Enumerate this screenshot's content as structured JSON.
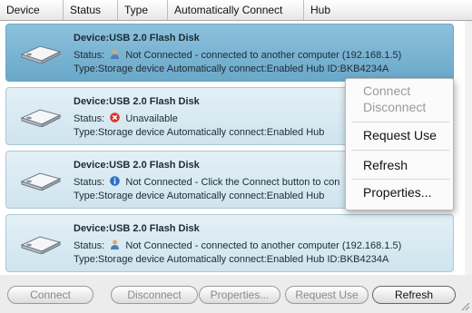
{
  "columns": [
    "Device",
    "Status",
    "Type",
    "Automatically Connect",
    "Hub"
  ],
  "devices": [
    {
      "title": "Device:USB 2.0 Flash Disk",
      "status_prefix": "Status:",
      "status_icon": "user-icon",
      "status_text": "Not Connected - connected to another computer (192.168.1.5)",
      "type_text": "Type:Storage device   Automatically connect:Enabled   Hub ID:BKB4234A",
      "selected": true
    },
    {
      "title": "Device:USB 2.0 Flash Disk",
      "status_prefix": "Status:",
      "status_icon": "error-icon",
      "status_text": "Unavailable",
      "type_text": "Type:Storage device   Automatically connect:Enabled   Hub",
      "selected": false
    },
    {
      "title": "Device:USB 2.0 Flash Disk",
      "status_prefix": "Status:",
      "status_icon": "info-icon",
      "status_text": "Not Connected - Click the Connect button to con",
      "type_text": "Type:Storage device   Automatically connect:Enabled   Hub",
      "selected": false
    },
    {
      "title": "Device:USB 2.0 Flash Disk",
      "status_prefix": "Status:",
      "status_icon": "user-icon",
      "status_text": "Not Connected - connected to another computer (192.168.1.5)",
      "type_text": "Type:Storage device   Automatically connect:Enabled   Hub ID:BKB4234A",
      "selected": false
    }
  ],
  "context_menu": {
    "items": [
      {
        "label": "Connect",
        "enabled": false
      },
      {
        "label": "Disconnect",
        "enabled": false
      },
      {
        "label": "Request Use",
        "enabled": true
      },
      {
        "label": "Refresh",
        "enabled": true
      },
      {
        "label": "Properties...",
        "enabled": true
      }
    ]
  },
  "buttons": {
    "connect": "Connect",
    "disconnect": "Disconnect",
    "properties": "Properties...",
    "request_use": "Request Use",
    "refresh": "Refresh"
  },
  "colors": {
    "selected_card": "#7fb6d4",
    "card": "#d8eaf3",
    "error": "#d9342b",
    "info": "#2a6fc9"
  }
}
